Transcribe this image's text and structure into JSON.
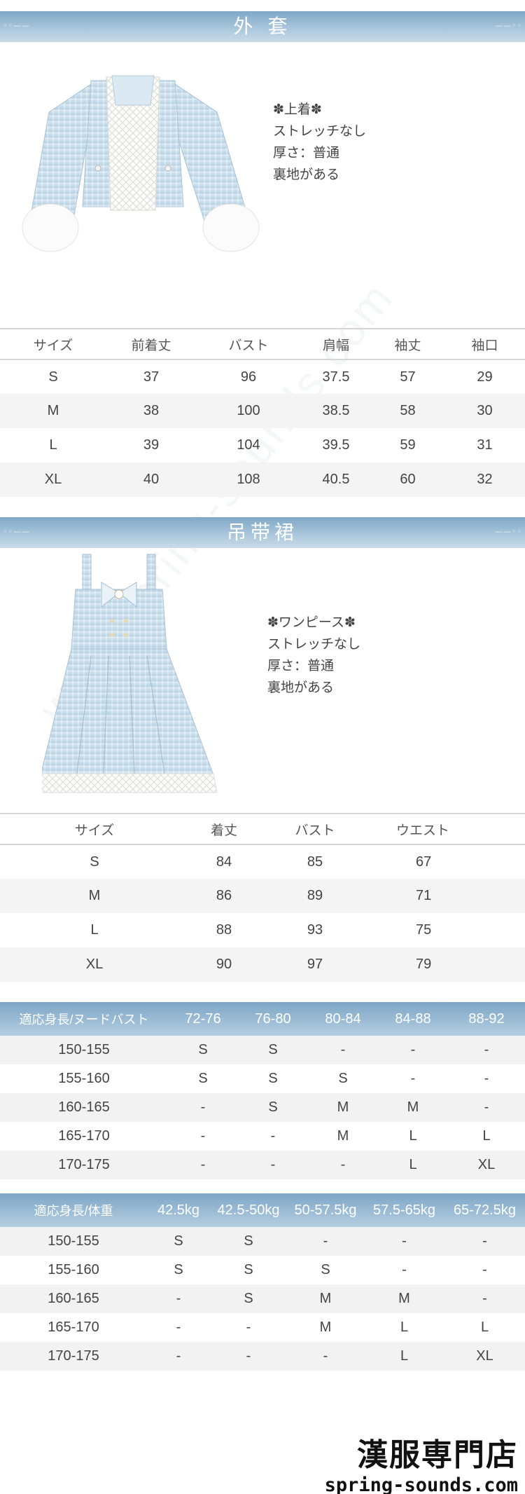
{
  "coat": {
    "header": "外 套",
    "desc": [
      "✽上着✽",
      "ストレッチなし",
      "厚さ：普通",
      "裏地がある"
    ],
    "headers": [
      "サイズ",
      "前着丈",
      "バスト",
      "肩幅",
      "袖丈",
      "袖口"
    ],
    "rows": [
      [
        "S",
        "37",
        "96",
        "37.5",
        "57",
        "29"
      ],
      [
        "M",
        "38",
        "100",
        "38.5",
        "58",
        "30"
      ],
      [
        "L",
        "39",
        "104",
        "39.5",
        "59",
        "31"
      ],
      [
        "XL",
        "40",
        "108",
        "40.5",
        "60",
        "32"
      ]
    ]
  },
  "dress": {
    "header": "吊带裙",
    "desc": [
      "✽ワンピース✽",
      "ストレッチなし",
      "厚さ：普通",
      "裏地がある"
    ],
    "headers": [
      "サイズ",
      "着丈",
      "バスト",
      "ウエスト"
    ],
    "rows": [
      [
        "S",
        "84",
        "85",
        "67"
      ],
      [
        "M",
        "86",
        "89",
        "71"
      ],
      [
        "L",
        "88",
        "93",
        "75"
      ],
      [
        "XL",
        "90",
        "97",
        "79"
      ]
    ]
  },
  "fit_bust": {
    "headers": [
      "適応身長/ヌードバスト",
      "72-76",
      "76-80",
      "80-84",
      "84-88",
      "88-92"
    ],
    "rows": [
      [
        "150-155",
        "S",
        "S",
        "-",
        "-",
        "-"
      ],
      [
        "155-160",
        "S",
        "S",
        "S",
        "-",
        "-"
      ],
      [
        "160-165",
        "-",
        "S",
        "M",
        "M",
        "-"
      ],
      [
        "165-170",
        "-",
        "-",
        "M",
        "L",
        "L"
      ],
      [
        "170-175",
        "-",
        "-",
        "-",
        "L",
        "XL"
      ]
    ]
  },
  "fit_weight": {
    "headers": [
      "適応身長/体重",
      "42.5kg",
      "42.5-50kg",
      "50-57.5kg",
      "57.5-65kg",
      "65-72.5kg"
    ],
    "rows": [
      [
        "150-155",
        "S",
        "S",
        "-",
        "-",
        "-"
      ],
      [
        "155-160",
        "S",
        "S",
        "S",
        "-",
        "-"
      ],
      [
        "160-165",
        "-",
        "S",
        "M",
        "M",
        "-"
      ],
      [
        "165-170",
        "-",
        "-",
        "M",
        "L",
        "L"
      ],
      [
        "170-175",
        "-",
        "-",
        "-",
        "L",
        "XL"
      ]
    ]
  },
  "watermark": "www.spring-sounds.com",
  "logo": {
    "line1": "漢服専門店",
    "line2": "spring-sounds.com"
  },
  "colors": {
    "band": "#9dbcd5",
    "fabric": "#c9dce9",
    "trim": "#f4f4f2"
  }
}
